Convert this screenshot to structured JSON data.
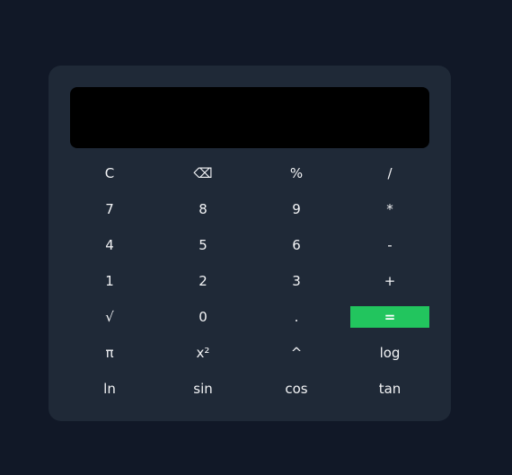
{
  "display": {
    "value": ""
  },
  "keys": [
    {
      "name": "clear-button",
      "label": "C"
    },
    {
      "name": "backspace-button",
      "label": "⌫"
    },
    {
      "name": "percent-button",
      "label": "%"
    },
    {
      "name": "divide-button",
      "label": "/"
    },
    {
      "name": "digit-7-button",
      "label": "7"
    },
    {
      "name": "digit-8-button",
      "label": "8"
    },
    {
      "name": "digit-9-button",
      "label": "9"
    },
    {
      "name": "multiply-button",
      "label": "*"
    },
    {
      "name": "digit-4-button",
      "label": "4"
    },
    {
      "name": "digit-5-button",
      "label": "5"
    },
    {
      "name": "digit-6-button",
      "label": "6"
    },
    {
      "name": "subtract-button",
      "label": "-"
    },
    {
      "name": "digit-1-button",
      "label": "1"
    },
    {
      "name": "digit-2-button",
      "label": "2"
    },
    {
      "name": "digit-3-button",
      "label": "3"
    },
    {
      "name": "add-button",
      "label": "+"
    },
    {
      "name": "sqrt-button",
      "label": "√"
    },
    {
      "name": "digit-0-button",
      "label": "0"
    },
    {
      "name": "decimal-button",
      "label": "."
    },
    {
      "name": "equals-button",
      "label": "="
    },
    {
      "name": "pi-button",
      "label": "π"
    },
    {
      "name": "square-button",
      "label": "x²"
    },
    {
      "name": "power-button",
      "label": "^"
    },
    {
      "name": "log-button",
      "label": "log"
    },
    {
      "name": "ln-button",
      "label": "ln"
    },
    {
      "name": "sin-button",
      "label": "sin"
    },
    {
      "name": "cos-button",
      "label": "cos"
    },
    {
      "name": "tan-button",
      "label": "tan"
    }
  ],
  "colors": {
    "background": "#111827",
    "panel": "#1f2937",
    "display": "#000000",
    "accent": "#22c55e"
  }
}
